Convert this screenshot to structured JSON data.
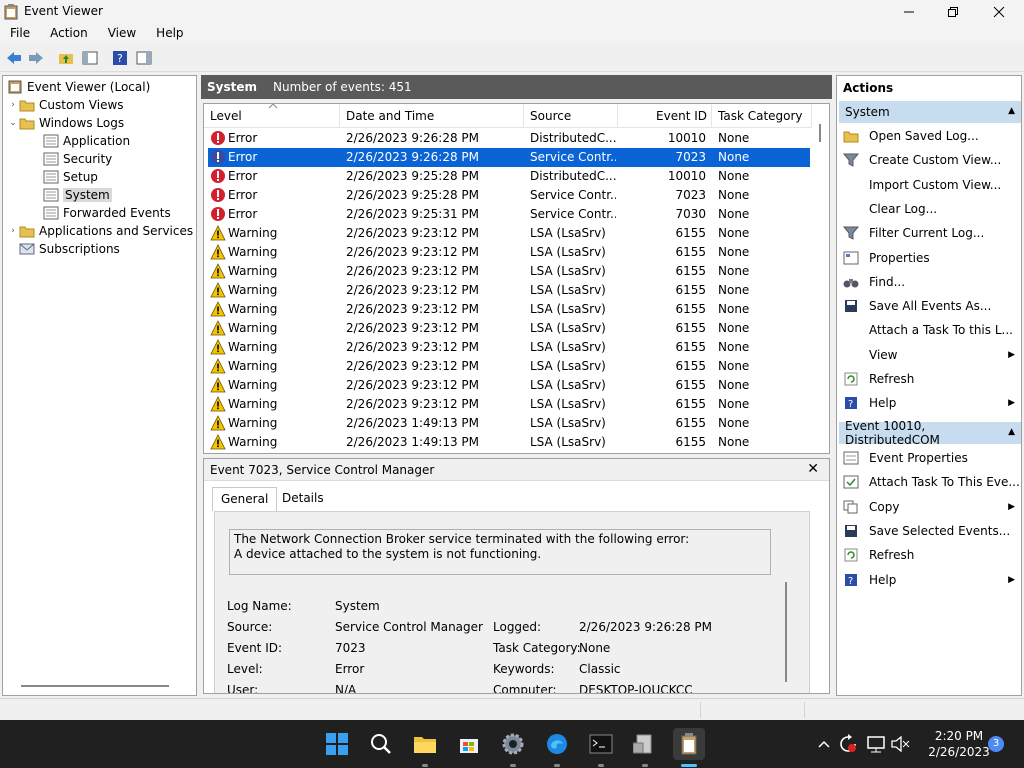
{
  "window": {
    "title": "Event Viewer"
  },
  "menu": [
    "File",
    "Action",
    "View",
    "Help"
  ],
  "tree": {
    "root": "Event Viewer (Local)",
    "custom_views": "Custom Views",
    "windows_logs": "Windows Logs",
    "application": "Application",
    "security": "Security",
    "setup": "Setup",
    "system": "System",
    "forwarded": "Forwarded Events",
    "apps_services": "Applications and Services Lo",
    "subscriptions": "Subscriptions"
  },
  "log": {
    "name": "System",
    "count": "Number of events: 451",
    "columns": {
      "level": "Level",
      "date": "Date and Time",
      "source": "Source",
      "event_id": "Event ID",
      "task": "Task Category"
    },
    "rows": [
      {
        "level": "Error",
        "date": "2/26/2023 9:26:28 PM",
        "source": "DistributedC...",
        "event_id": "10010",
        "task": "None"
      },
      {
        "level": "Error",
        "date": "2/26/2023 9:26:28 PM",
        "source": "Service Contr...",
        "event_id": "7023",
        "task": "None"
      },
      {
        "level": "Error",
        "date": "2/26/2023 9:25:28 PM",
        "source": "DistributedC...",
        "event_id": "10010",
        "task": "None"
      },
      {
        "level": "Error",
        "date": "2/26/2023 9:25:28 PM",
        "source": "Service Contr...",
        "event_id": "7023",
        "task": "None"
      },
      {
        "level": "Error",
        "date": "2/26/2023 9:25:31 PM",
        "source": "Service Contr...",
        "event_id": "7030",
        "task": "None"
      },
      {
        "level": "Warning",
        "date": "2/26/2023 9:23:12 PM",
        "source": "LSA (LsaSrv)",
        "event_id": "6155",
        "task": "None"
      },
      {
        "level": "Warning",
        "date": "2/26/2023 9:23:12 PM",
        "source": "LSA (LsaSrv)",
        "event_id": "6155",
        "task": "None"
      },
      {
        "level": "Warning",
        "date": "2/26/2023 9:23:12 PM",
        "source": "LSA (LsaSrv)",
        "event_id": "6155",
        "task": "None"
      },
      {
        "level": "Warning",
        "date": "2/26/2023 9:23:12 PM",
        "source": "LSA (LsaSrv)",
        "event_id": "6155",
        "task": "None"
      },
      {
        "level": "Warning",
        "date": "2/26/2023 9:23:12 PM",
        "source": "LSA (LsaSrv)",
        "event_id": "6155",
        "task": "None"
      },
      {
        "level": "Warning",
        "date": "2/26/2023 9:23:12 PM",
        "source": "LSA (LsaSrv)",
        "event_id": "6155",
        "task": "None"
      },
      {
        "level": "Warning",
        "date": "2/26/2023 9:23:12 PM",
        "source": "LSA (LsaSrv)",
        "event_id": "6155",
        "task": "None"
      },
      {
        "level": "Warning",
        "date": "2/26/2023 9:23:12 PM",
        "source": "LSA (LsaSrv)",
        "event_id": "6155",
        "task": "None"
      },
      {
        "level": "Warning",
        "date": "2/26/2023 9:23:12 PM",
        "source": "LSA (LsaSrv)",
        "event_id": "6155",
        "task": "None"
      },
      {
        "level": "Warning",
        "date": "2/26/2023 9:23:12 PM",
        "source": "LSA (LsaSrv)",
        "event_id": "6155",
        "task": "None"
      },
      {
        "level": "Warning",
        "date": "2/26/2023 1:49:13 PM",
        "source": "LSA (LsaSrv)",
        "event_id": "6155",
        "task": "None"
      },
      {
        "level": "Warning",
        "date": "2/26/2023 1:49:13 PM",
        "source": "LSA (LsaSrv)",
        "event_id": "6155",
        "task": "None"
      }
    ]
  },
  "detail": {
    "title": "Event 7023, Service Control Manager",
    "tabs": [
      "General",
      "Details"
    ],
    "message_line1": "The Network Connection Broker service terminated with the following error:",
    "message_line2": "A device attached to the system is not functioning.",
    "log_name_label": "Log Name:",
    "log_name": "System",
    "source_label": "Source:",
    "source": "Service Control Manager",
    "logged_label": "Logged:",
    "logged": "2/26/2023 9:26:28 PM",
    "event_id_label": "Event ID:",
    "event_id": "7023",
    "task_label": "Task Category:",
    "task": "None",
    "level_label": "Level:",
    "level": "Error",
    "keywords_label": "Keywords:",
    "keywords": "Classic",
    "user_label": "User:",
    "user": "N/A",
    "computer_label": "Computer:",
    "computer": "DESKTOP-IOUCKCC"
  },
  "actions": {
    "title": "Actions",
    "section1": "System",
    "items1": [
      "Open Saved Log...",
      "Create Custom View...",
      "Import Custom View...",
      "Clear Log...",
      "Filter Current Log...",
      "Properties",
      "Find...",
      "Save All Events As...",
      "Attach a Task To this L...",
      "View",
      "Refresh",
      "Help"
    ],
    "section2": "Event 10010, DistributedCOM",
    "items2": [
      "Event Properties",
      "Attach Task To This Eve...",
      "Copy",
      "Save Selected Events...",
      "Refresh",
      "Help"
    ]
  },
  "taskbar": {
    "time": "2:20 PM",
    "date": "2/26/2023",
    "notifications": "3"
  },
  "colors": {
    "selection": "#0a64d6",
    "section": "#c8dcf0",
    "taskbar": "#202020",
    "error": "#d3202e",
    "warning": "#f5c400"
  }
}
